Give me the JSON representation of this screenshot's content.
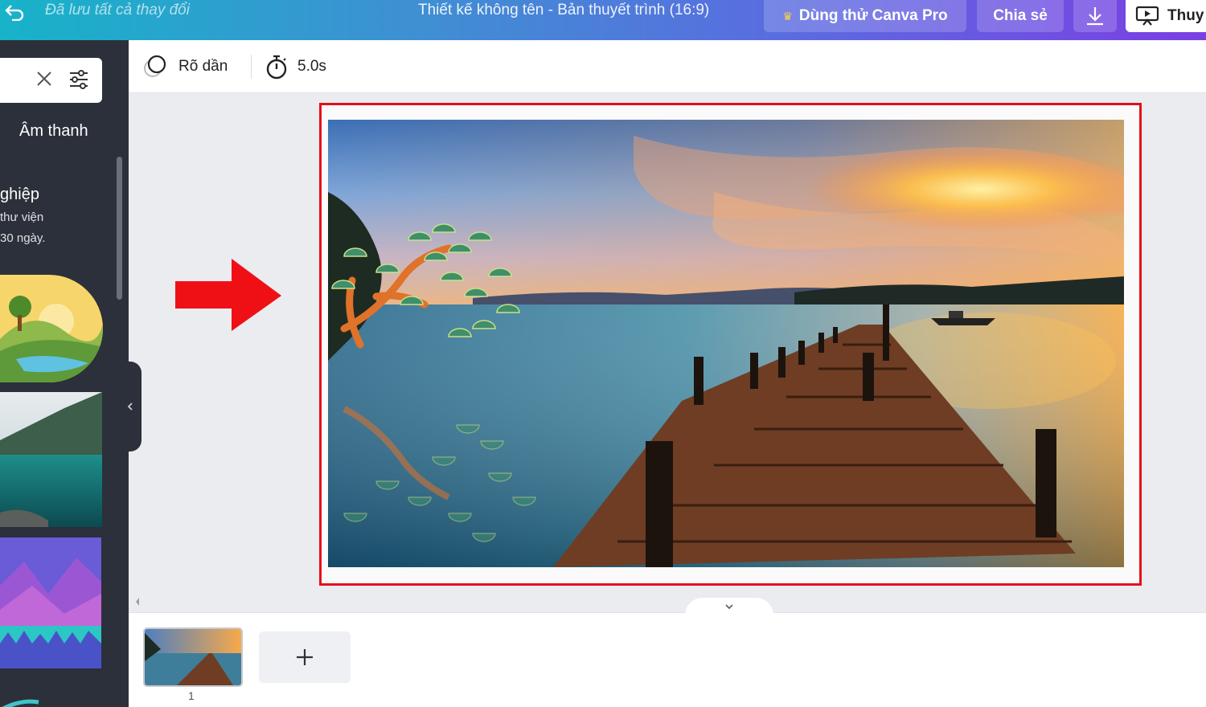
{
  "topbar": {
    "saved_status": "Đã lưu tất cả thay đổi",
    "document_title": "Thiết kế không tên - Bản thuyết trình (16:9)",
    "try_pro_label": "Dùng thử Canva Pro",
    "share_label": "Chia sẻ",
    "present_label": "Thuy"
  },
  "toolbar": {
    "transition_label": "Rõ dần",
    "duration_label": "5.0s"
  },
  "sidebar": {
    "audio_tab_label": "Âm thanh",
    "promo_title": "ghiệp",
    "promo_line1": "thư viện",
    "promo_line2": "30 ngày."
  },
  "pages": {
    "current_page_number": "1"
  },
  "colors": {
    "highlight": "#e3101a",
    "sidebar_bg": "#2b303a",
    "canvas_bg": "#ebecf0"
  }
}
